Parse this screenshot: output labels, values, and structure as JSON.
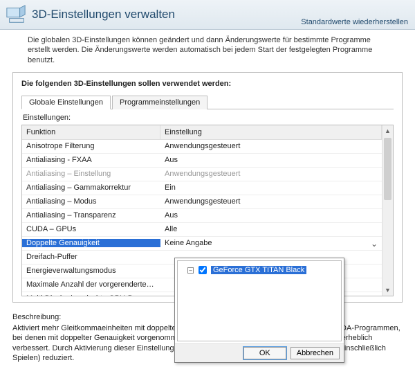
{
  "header": {
    "title": "3D-Einstellungen verwalten",
    "restore_defaults": "Standardwerte wiederherstellen"
  },
  "intro": "Die globalen 3D-Einstellungen können geändert und dann Änderungswerte für bestimmte Programme erstellt werden. Die Änderungswerte werden automatisch bei jedem Start der festgelegten Programme benutzt.",
  "panel": {
    "title": "Die folgenden 3D-Einstellungen sollen verwendet werden:",
    "tabs": {
      "global": "Globale Einstellungen",
      "program": "Programmeinstellungen"
    },
    "settings_label": "Einstellungen:",
    "columns": {
      "function": "Funktion",
      "setting": "Einstellung"
    },
    "rows": [
      {
        "fn": "Anisotrope Filterung",
        "val": "Anwendungsgesteuert"
      },
      {
        "fn": "Antialiasing - FXAA",
        "val": "Aus"
      },
      {
        "fn": "Antialiasing – Einstellung",
        "val": "Anwendungsgesteuert",
        "disabled": true
      },
      {
        "fn": "Antialiasing – Gammakorrektur",
        "val": "Ein"
      },
      {
        "fn": "Antialiasing – Modus",
        "val": "Anwendungsgesteuert"
      },
      {
        "fn": "Antialiasing – Transparenz",
        "val": "Aus"
      },
      {
        "fn": "CUDA – GPUs",
        "val": "Alle"
      },
      {
        "fn": "Doppelte Genauigkeit",
        "val": "Keine Angabe",
        "selected": true
      },
      {
        "fn": "Dreifach-Puffer",
        "val": ""
      },
      {
        "fn": "Energieverwaltungsmodus",
        "val": ""
      },
      {
        "fn": "Maximale Anzahl der vorgerenderten Einz…",
        "val": ""
      },
      {
        "fn": "Multi-Display/gemischte GPU-Beschleunigung",
        "val": ""
      }
    ]
  },
  "description": {
    "label": "Beschreibung:",
    "text": "Aktiviert mehr Gleitkommaeinheiten mit doppelter Genauigkeit. Dadurch wird die Leistung von CUDA-Programmen, bei denen mit doppelter Genauigkeit vorgenommenen Berechnungen eine wichtige Rolle spielen, erheblich verbessert. Durch Aktivierung dieser Einstellung wird die Leistung aller Nicht-CUDA-Programme (einschließlich Spielen) reduziert."
  },
  "popup": {
    "gpu": "GeForce GTX TITAN Black",
    "ok": "OK",
    "cancel": "Abbrechen"
  }
}
